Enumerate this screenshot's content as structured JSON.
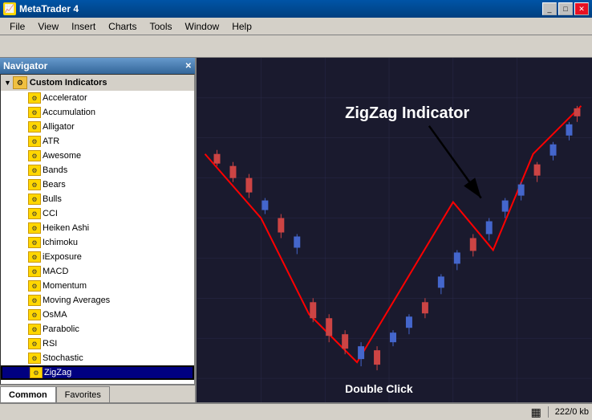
{
  "titleBar": {
    "title": "MetaTrader 4",
    "icon": "MT",
    "controls": [
      "minimize",
      "maximize",
      "close"
    ]
  },
  "menuBar": {
    "items": [
      "File",
      "View",
      "Insert",
      "Charts",
      "Tools",
      "Window",
      "Help"
    ]
  },
  "navigator": {
    "title": "Navigator",
    "tree": {
      "root": {
        "label": "Custom Indicators",
        "expanded": true,
        "items": [
          "Accelerator",
          "Accumulation",
          "Alligator",
          "ATR",
          "Awesome",
          "Bands",
          "Bears",
          "Bulls",
          "CCI",
          "Heiken Ashi",
          "Ichimoku",
          "iExposure",
          "MACD",
          "Momentum",
          "Moving Averages",
          "OsMA",
          "Parabolic",
          "RSI",
          "Stochastic",
          "ZigZag"
        ]
      }
    }
  },
  "tabs": {
    "items": [
      "Common",
      "Favorites"
    ],
    "active": "Common"
  },
  "chart": {
    "annotation": "ZigZag Indicator",
    "doubleClick": "Double Click"
  },
  "statusBar": {
    "icon": "bars-icon",
    "memory": "222/0 kb"
  }
}
